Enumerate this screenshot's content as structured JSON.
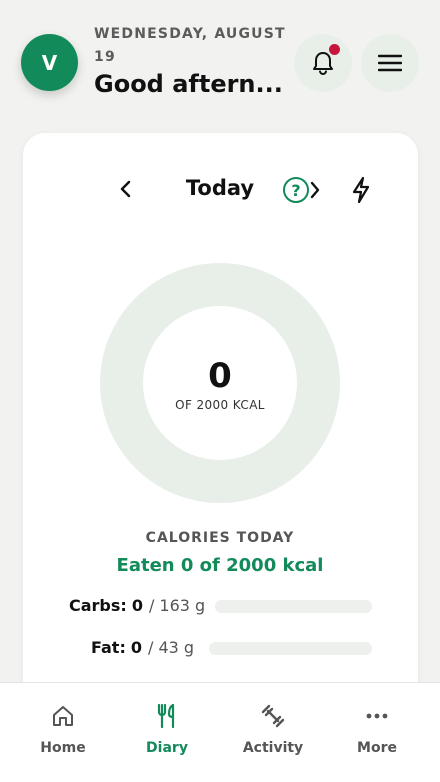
{
  "header": {
    "avatar_initial": "V",
    "date": "WEDNESDAY, AUGUST 19",
    "greeting": "Good aftern..."
  },
  "notifications": {
    "has_unread": true,
    "dot_color": "#c8153c"
  },
  "day_nav": {
    "label": "Today",
    "help_glyph": "?"
  },
  "calories": {
    "eaten_value": "0",
    "of_goal_text": "OF 2000 KCAL",
    "section_title": "CALORIES TODAY",
    "summary": "Eaten 0 of 2000 kcal",
    "eaten": 0,
    "goal": 2000
  },
  "macros": [
    {
      "label": "Carbs:",
      "value": "0",
      "target": "/ 163 g",
      "progress": 0
    },
    {
      "label": "Fat:",
      "value": "0",
      "target": "/ 43 g",
      "progress": 0
    }
  ],
  "bottom_nav": [
    {
      "label": "Home",
      "icon": "home-icon",
      "active": false
    },
    {
      "label": "Diary",
      "icon": "fork-knife-icon",
      "active": true
    },
    {
      "label": "Activity",
      "icon": "dumbbell-icon",
      "active": false
    },
    {
      "label": "More",
      "icon": "more-icon",
      "active": false
    }
  ],
  "colors": {
    "accent": "#128a5a",
    "ring_track": "#e8efe9",
    "background": "#f2f3f1"
  }
}
